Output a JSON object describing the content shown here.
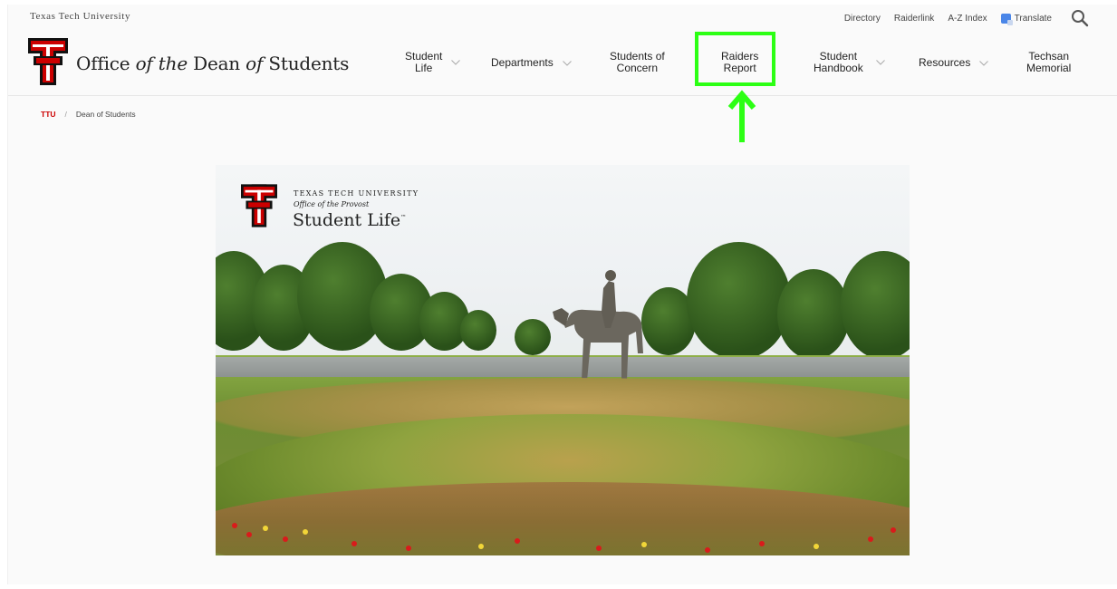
{
  "utility_bar": {
    "site_name": "Texas Tech University",
    "links": [
      "Directory",
      "Raiderlink",
      "A-Z Index"
    ],
    "translate_label": "Translate"
  },
  "header": {
    "title_part1": "Office ",
    "title_part2": "of the",
    "title_part3": " Dean ",
    "title_part4": "of",
    "title_part5": " Students"
  },
  "nav": {
    "items": [
      {
        "label_line1": "Student",
        "label_line2": "Life",
        "has_dropdown": true
      },
      {
        "label_line1": "Departments",
        "label_line2": "",
        "has_dropdown": true
      },
      {
        "label_line1": "Students of",
        "label_line2": "Concern",
        "has_dropdown": false
      },
      {
        "label_line1": "Raiders",
        "label_line2": "Report",
        "has_dropdown": false,
        "highlighted": true
      },
      {
        "label_line1": "Student",
        "label_line2": "Handbook",
        "has_dropdown": true
      },
      {
        "label_line1": "Resources",
        "label_line2": "",
        "has_dropdown": true
      },
      {
        "label_line1": "Techsan",
        "label_line2": "Memorial",
        "has_dropdown": false
      }
    ]
  },
  "breadcrumb": {
    "home": "TTU",
    "separator": "/",
    "current": "Dean of Students"
  },
  "hero": {
    "logo_line1": "TEXAS TECH UNIVERSITY",
    "logo_line2": "Office of the Provost",
    "logo_line3": "Student Life",
    "logo_mark": "™"
  },
  "colors": {
    "brand_red": "#cc0000",
    "highlight_green": "#2cff14"
  },
  "icons": {
    "search": "search-icon",
    "translate": "translate-icon",
    "chevron": "chevron-down-icon",
    "logo": "double-t-logo"
  }
}
